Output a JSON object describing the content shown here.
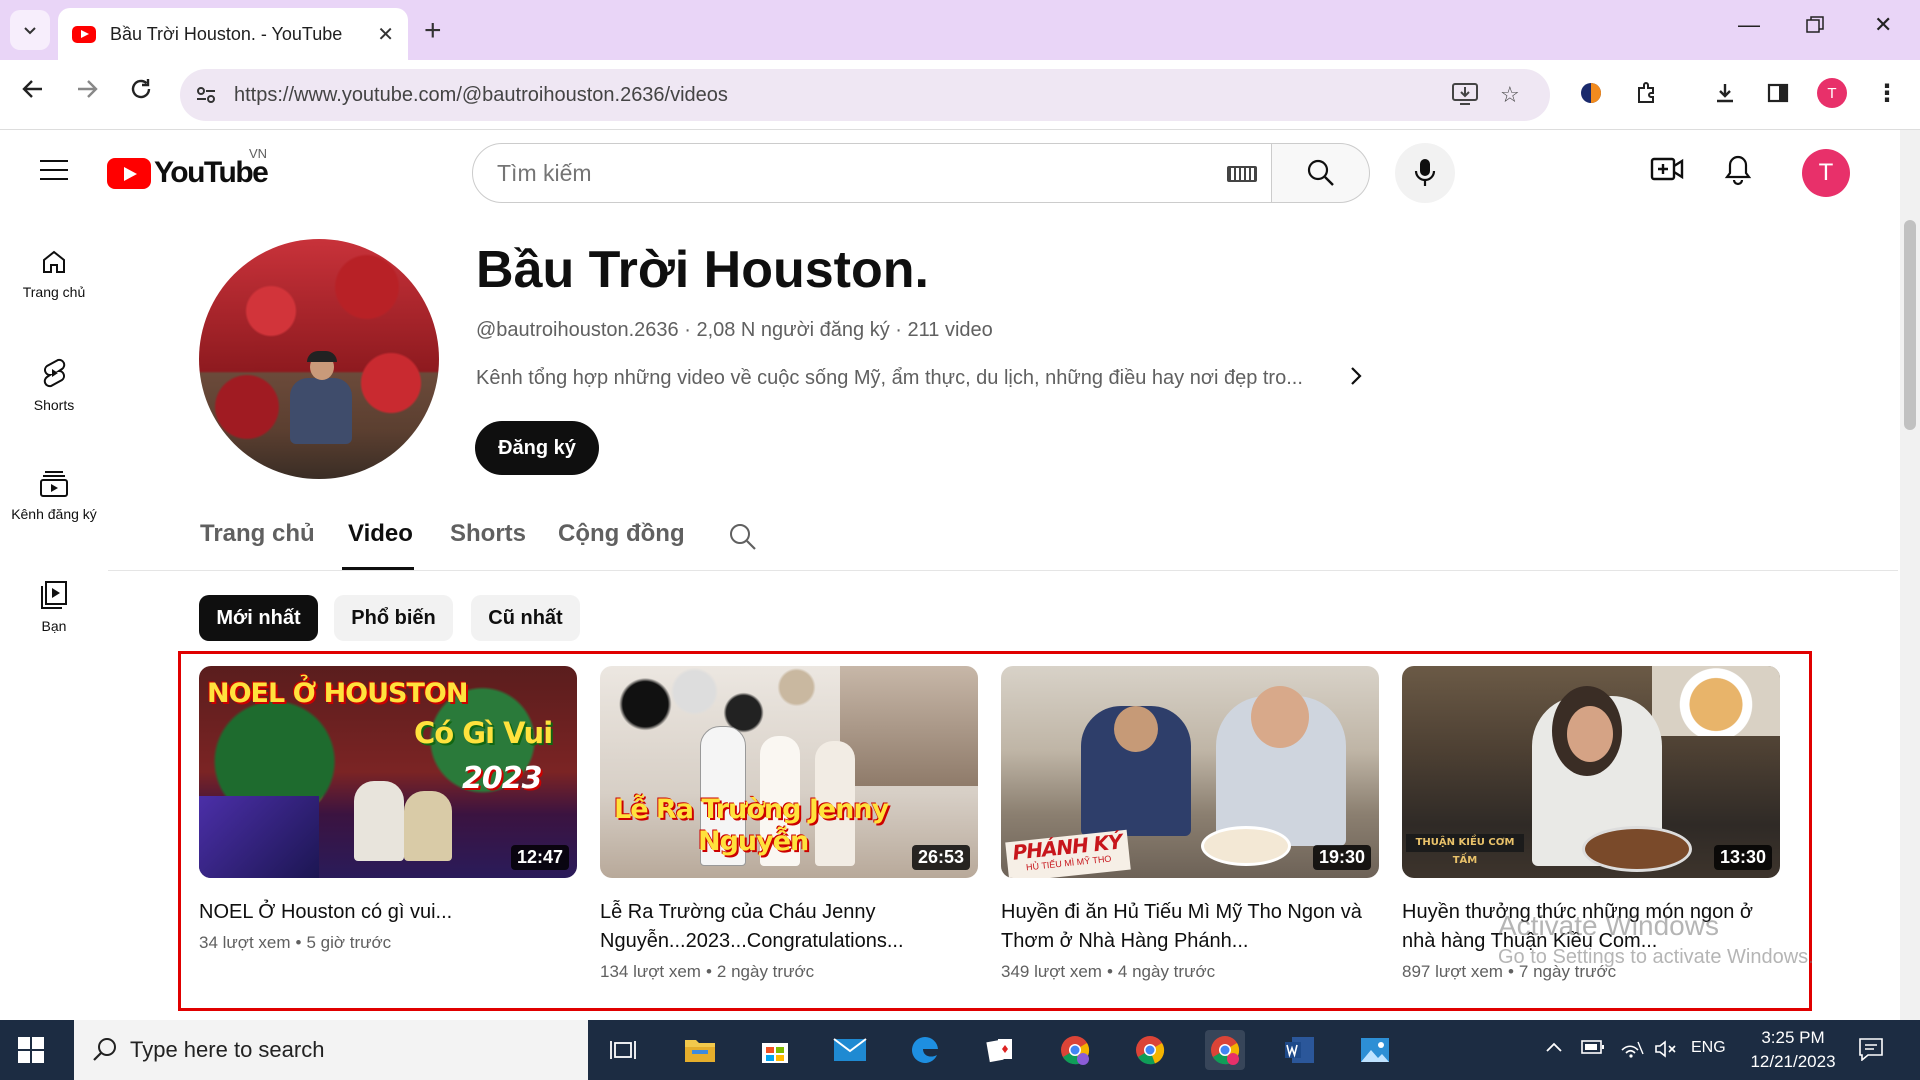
{
  "browser": {
    "tab_title": "Bầu Trời Houston. - YouTube",
    "url": "https://www.youtube.com/@bautroihouston.2636/videos",
    "profile_initial": "T"
  },
  "yt_header": {
    "logo_text": "YouTube",
    "country_code": "VN",
    "search_placeholder": "Tìm kiếm",
    "avatar_initial": "T"
  },
  "guide": [
    {
      "label": "Trang chủ",
      "icon": "home-icon"
    },
    {
      "label": "Shorts",
      "icon": "shorts-icon"
    },
    {
      "label": "Kênh đăng ký",
      "icon": "subscriptions-icon"
    },
    {
      "label": "Bạn",
      "icon": "you-library-icon"
    }
  ],
  "channel": {
    "name": "Bầu Trời Houston.",
    "meta": "@bautroihouston.2636 · 2,08 N người đăng ký · 211 video",
    "description": "Kênh tổng hợp những video về cuộc sống Mỹ, ẩm thực, du lịch, những điều hay nơi đẹp tro...",
    "subscribe_label": "Đăng ký"
  },
  "channel_tabs": [
    {
      "label": "Trang chủ",
      "active": false
    },
    {
      "label": "Video",
      "active": true
    },
    {
      "label": "Shorts",
      "active": false
    },
    {
      "label": "Cộng đồng",
      "active": false
    }
  ],
  "chips": [
    {
      "label": "Mới nhất",
      "active": true
    },
    {
      "label": "Phổ biến",
      "active": false
    },
    {
      "label": "Cũ nhất",
      "active": false
    }
  ],
  "videos": [
    {
      "title": "NOEL Ở Houston có gì vui...",
      "views": "34 lượt xem",
      "age": "5 giờ trước",
      "duration": "12:47",
      "thumb_line1": "NOEL Ở HOUSTON",
      "thumb_line2": "Có Gì Vui",
      "thumb_line3": "2023"
    },
    {
      "title": "Lễ Ra Trường của Cháu Jenny Nguyễn...2023...Congratulations...",
      "views": "134 lượt xem",
      "age": "2 ngày trước",
      "duration": "26:53",
      "thumb_line1": "Lễ Ra Trường Jenny",
      "thumb_line2": "Nguyễn"
    },
    {
      "title": "Huyền đi ăn Hủ Tiếu Mì Mỹ Tho Ngon và Thơm ở Nhà Hàng Phánh...",
      "views": "349 lượt xem",
      "age": "4 ngày trước",
      "duration": "19:30",
      "thumb_sign": "PHÁNH KÝ",
      "thumb_sign_sub": "HỦ TIẾU MÌ MỸ THO"
    },
    {
      "title": "Huyền thưởng thức những món ngon ở nhà hàng Thuận Kiều Com...",
      "views": "897 lượt xem",
      "age": "7 ngày trước",
      "duration": "13:30",
      "thumb_sign": "THUẬN KIỀU CƠM TẤM"
    }
  ],
  "watermark": {
    "line1": "Activate Windows",
    "line2": "Go to Settings to activate Windows."
  },
  "taskbar": {
    "search_placeholder": "Type here to search",
    "language": "ENG",
    "time": "3:25 PM",
    "date": "12/21/2023"
  },
  "colors": {
    "tabbar_bg": "#e9d5f7",
    "youtube_red": "#ff0000",
    "highlight_box": "#e00000",
    "avatar_pink": "#e8306a",
    "taskbar_bg": "#1c2c42"
  }
}
